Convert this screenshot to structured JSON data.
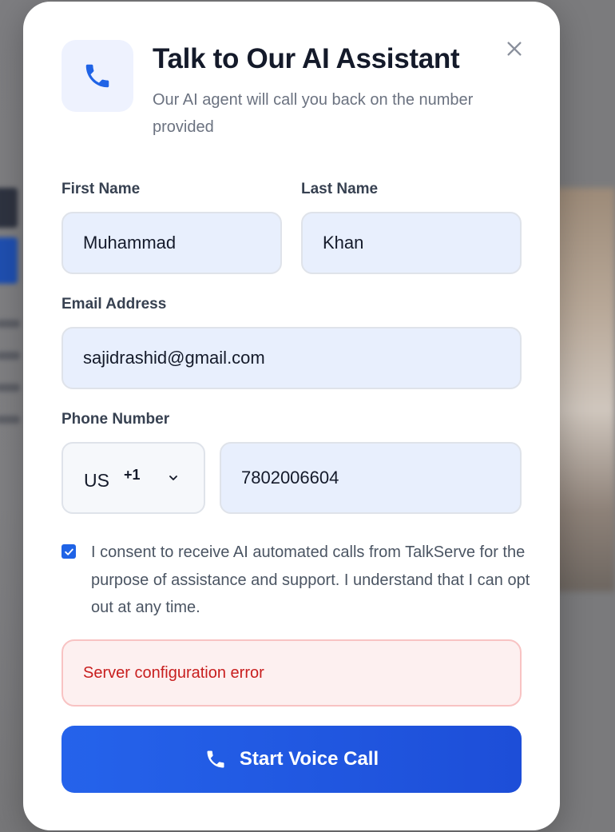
{
  "modal": {
    "title": "Talk to Our AI Assistant",
    "subtitle": "Our AI agent will call you back on the number provided",
    "header_icon": "phone-icon",
    "close_icon": "close-icon"
  },
  "form": {
    "first_name": {
      "label": "First Name",
      "value": "Muhammad"
    },
    "last_name": {
      "label": "Last Name",
      "value": "Khan"
    },
    "email": {
      "label": "Email Address",
      "value": "sajidrashid@gmail.com"
    },
    "phone": {
      "label": "Phone Number",
      "country_code": "US",
      "dial_code": "+1",
      "value": "7802006604"
    },
    "consent": {
      "checked": true,
      "text": "I consent to receive AI automated calls from TalkServe for the purpose of assistance and support. I understand that I can opt out at any time."
    }
  },
  "error": {
    "message": "Server configuration error"
  },
  "submit": {
    "label": "Start Voice Call",
    "icon": "phone-icon"
  },
  "colors": {
    "primary": "#2563eb",
    "error_text": "#c81e1e",
    "error_bg": "#fdf0f0",
    "input_bg": "#e8effd"
  }
}
